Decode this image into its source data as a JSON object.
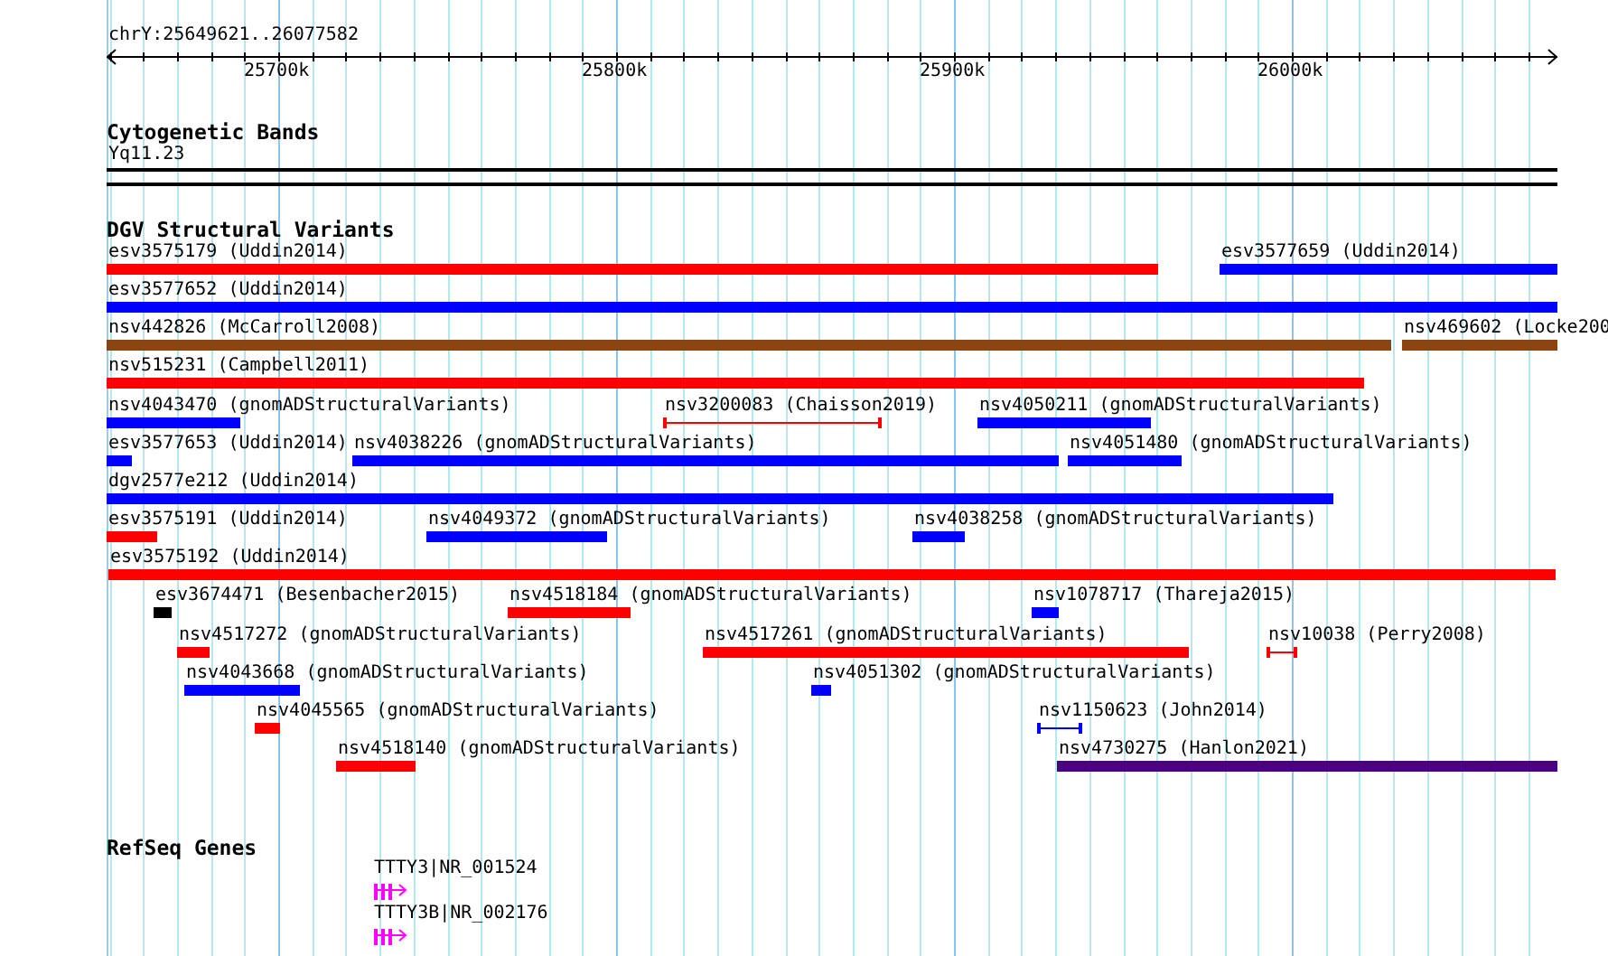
{
  "ruler": {
    "location": "chrY:25649621..26077582",
    "ticks": [
      "25700k",
      "25800k",
      "25900k",
      "26000k"
    ]
  },
  "bands": {
    "title": "Cytogenetic Bands",
    "label": "Yq11.23"
  },
  "variants": {
    "title": "DGV Structural Variants",
    "rows": [
      [
        {
          "label": "esv3575179 (Uddin2014)",
          "color": "#ff0000",
          "kind": "bar"
        },
        {
          "label": "esv3577659 (Uddin2014)",
          "color": "#0000ff",
          "kind": "bar"
        }
      ],
      [
        {
          "label": "esv3577652 (Uddin2014)",
          "color": "#0000ff",
          "kind": "bar"
        }
      ],
      [
        {
          "label": "nsv442826 (McCarroll2008)",
          "color": "#8b4513",
          "kind": "bar"
        },
        {
          "label": "nsv469602 (Locke200",
          "color": "#8b4513",
          "kind": "bar"
        }
      ],
      [
        {
          "label": "nsv515231 (Campbell2011)",
          "color": "#ff0000",
          "kind": "bar"
        }
      ],
      [
        {
          "label": "nsv4043470 (gnomADStructuralVariants)",
          "color": "#0000ff",
          "kind": "bar"
        },
        {
          "label": "nsv3200083 (Chaisson2019)",
          "color": "#ff0000",
          "kind": "interval"
        },
        {
          "label": "nsv4050211 (gnomADStructuralVariants)",
          "color": "#0000ff",
          "kind": "bar"
        }
      ],
      [
        {
          "label": "esv3577653 (Uddin2014)",
          "color": "#0000ff",
          "kind": "bar"
        },
        {
          "label": "nsv4038226 (gnomADStructuralVariants)",
          "color": "#0000ff",
          "kind": "bar"
        },
        {
          "label": "nsv4051480 (gnomADStructuralVariants)",
          "color": "#0000ff",
          "kind": "bar"
        }
      ],
      [
        {
          "label": "dgv2577e212 (Uddin2014)",
          "color": "#0000ff",
          "kind": "bar"
        }
      ],
      [
        {
          "label": "esv3575191 (Uddin2014)",
          "color": "#ff0000",
          "kind": "bar"
        },
        {
          "label": "nsv4049372 (gnomADStructuralVariants)",
          "color": "#0000ff",
          "kind": "bar"
        },
        {
          "label": "nsv4038258 (gnomADStructuralVariants)",
          "color": "#0000ff",
          "kind": "bar"
        }
      ],
      [
        {
          "label": "esv3575192 (Uddin2014)",
          "color": "#ff0000",
          "kind": "bar"
        }
      ],
      [
        {
          "label": "esv3674471 (Besenbacher2015)",
          "color": "#000000",
          "kind": "bar"
        },
        {
          "label": "nsv4518184 (gnomADStructuralVariants)",
          "color": "#ff0000",
          "kind": "bar"
        },
        {
          "label": "nsv1078717 (Thareja2015)",
          "color": "#0000ff",
          "kind": "bar"
        }
      ],
      [
        {
          "label": "nsv4517272 (gnomADStructuralVariants)",
          "color": "#ff0000",
          "kind": "bar"
        },
        {
          "label": "nsv4517261 (gnomADStructuralVariants)",
          "color": "#ff0000",
          "kind": "bar"
        },
        {
          "label": "nsv10038 (Perry2008)",
          "color": "#ff0000",
          "kind": "interval"
        }
      ],
      [
        {
          "label": "nsv4043668 (gnomADStructuralVariants)",
          "color": "#0000ff",
          "kind": "bar"
        },
        {
          "label": "nsv4051302 (gnomADStructuralVariants)",
          "color": "#0000ff",
          "kind": "bar"
        }
      ],
      [
        {
          "label": "nsv4045565 (gnomADStructuralVariants)",
          "color": "#ff0000",
          "kind": "bar"
        },
        {
          "label": "nsv1150623 (John2014)",
          "color": "#0000ff",
          "kind": "interval"
        }
      ],
      [
        {
          "label": "nsv4518140 (gnomADStructuralVariants)",
          "color": "#ff0000",
          "kind": "bar"
        },
        {
          "label": "nsv4730275 (Hanlon2021)",
          "color": "#4b0082",
          "kind": "bar"
        }
      ]
    ]
  },
  "genes": {
    "title": "RefSeq Genes",
    "features": [
      {
        "label": "TTTY3|NR_001524",
        "color": "#ff00ff"
      },
      {
        "label": "TTTY3B|NR_002176",
        "color": "#ff00ff"
      }
    ]
  }
}
